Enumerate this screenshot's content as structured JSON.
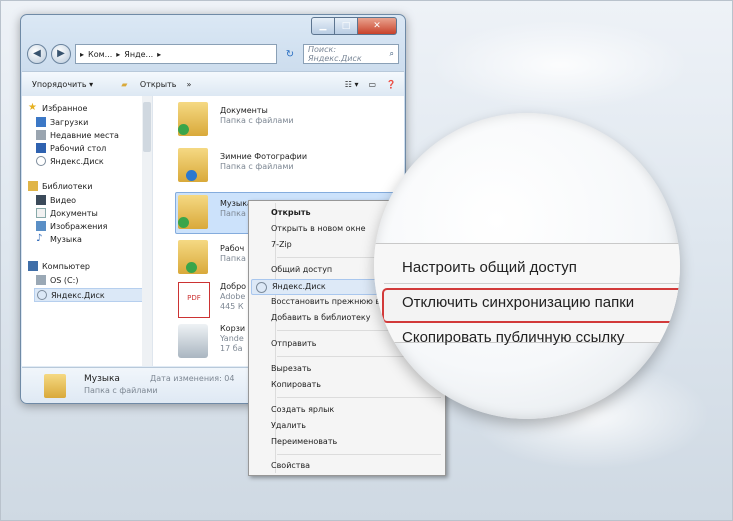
{
  "window": {
    "crumbs": [
      "Ком...",
      "Янде..."
    ],
    "search_placeholder": "Поиск: Яндекс.Диск",
    "toolbar": {
      "organize": "Упорядочить ▾",
      "open": "Открыть",
      "more": "»"
    },
    "nav": {
      "favorites": "Избранное",
      "favorites_items": [
        "Загрузки",
        "Недавние места",
        "Рабочий стол",
        "Яндекс.Диск"
      ],
      "libraries": "Библиотеки",
      "libraries_items": [
        "Видео",
        "Документы",
        "Изображения",
        "Музыка"
      ],
      "computer": "Компьютер",
      "computer_items": [
        "OS (C:)",
        "Яндекс.Диск"
      ]
    },
    "files": [
      {
        "name": "Документы",
        "sub": "Папка с файлами"
      },
      {
        "name": "Зимние Фотографии",
        "sub": "Папка с файлами"
      },
      {
        "name": "Музыка",
        "sub": "Папка"
      },
      {
        "name": "Рабоч",
        "sub": "Папка"
      },
      {
        "name": "Добро",
        "sub": "Adobe",
        "sub2": "445 К"
      },
      {
        "name": "Корзи",
        "sub": "Yande",
        "sub2": "17 ба"
      }
    ],
    "details": {
      "name": "Музыка",
      "sub": "Папка с файлами",
      "date": "Дата изменения: 04"
    }
  },
  "context_menu": {
    "items": [
      "Открыть",
      "Открыть в новом окне",
      "7-Zip",
      "Общий доступ",
      "Яндекс.Диск",
      "Восстановить прежнюю в",
      "Добавить в библиотеку",
      "Отправить",
      "Вырезать",
      "Копировать",
      "Создать ярлык",
      "Удалить",
      "Переименовать",
      "Свойства"
    ]
  },
  "magnified_submenu": {
    "items": [
      "Настроить общий доступ",
      "Отключить синхронизацию папки",
      "Скопировать публичную ссылку"
    ],
    "highlight_color": "#d23a3a"
  }
}
